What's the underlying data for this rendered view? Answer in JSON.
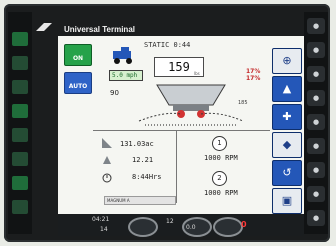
{
  "window": {
    "title": "Universal Terminal"
  },
  "sidebar_left": {
    "buttons": [
      {
        "label": "ON"
      },
      {
        "label": "AUTO"
      }
    ]
  },
  "main": {
    "status": "STATIC 0:44",
    "rate": "159",
    "rate_unit": "lbs",
    "setpoint": "5.0 mph",
    "tipping_value": "90",
    "left_pct": "17%",
    "right_pct": "17%",
    "right_rate": "185",
    "area": "131.03ac",
    "speed": "12.21",
    "time": "8:44Hrs",
    "pill": "MAGNUM A",
    "pto1_label": "1",
    "pto1": "1000 RPM",
    "pto2_label": "2",
    "pto2": "1000 RPM"
  },
  "bottom": {
    "time": "04:21",
    "gear": "14",
    "left_num": "12",
    "center_num": "0.0",
    "right_num": "0"
  },
  "colors": {
    "primary_green": "#26a24a",
    "primary_blue": "#2457b8",
    "warning_red": "#c42a2a"
  }
}
